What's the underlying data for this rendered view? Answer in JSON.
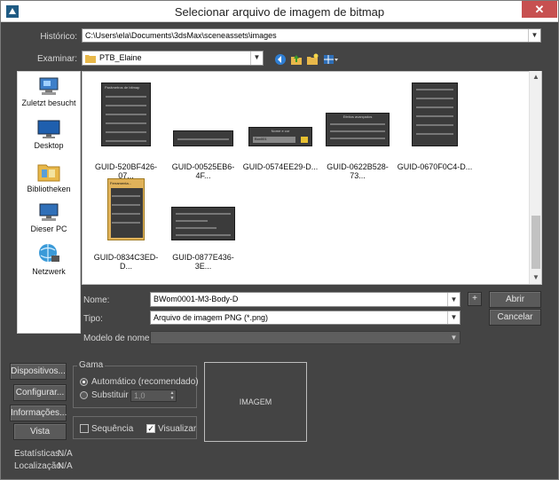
{
  "window": {
    "title": "Selecionar arquivo de imagem de bitmap",
    "close_glyph": "✕"
  },
  "history": {
    "label": "Histórico:",
    "value": "C:\\Users\\ela\\Documents\\3dsMax\\sceneassets\\images"
  },
  "look_in": {
    "label": "Examinar:",
    "value": "PTB_Elaine"
  },
  "toolbar": {
    "icons": [
      "back-icon",
      "up-folder-icon",
      "new-folder-icon",
      "view-menu-icon"
    ]
  },
  "places": [
    {
      "label": "Zuletzt besucht",
      "icon": "recent-places-icon"
    },
    {
      "label": "Desktop",
      "icon": "desktop-icon"
    },
    {
      "label": "Bibliotheken",
      "icon": "libraries-icon"
    },
    {
      "label": "Dieser PC",
      "icon": "computer-icon"
    },
    {
      "label": "Netzwerk",
      "icon": "network-icon"
    }
  ],
  "files": [
    {
      "name": "GUID-520BF426-07..."
    },
    {
      "name": "GUID-00525EB6-4F..."
    },
    {
      "name": "GUID-0574EE29-D..."
    },
    {
      "name": "GUID-0622B528-73..."
    },
    {
      "name": "GUID-0670F0C4-D..."
    },
    {
      "name": "GUID-0834C3ED-D..."
    },
    {
      "name": "GUID-0877E436-3E..."
    }
  ],
  "thumb_text": {
    "t1": "Parâmetros de bitmap",
    "t3": "Nome e cor",
    "t3_field": "Box001",
    "t4": "Efeitos avançados",
    "t6": "Ferramenta..."
  },
  "filename": {
    "label": "Nome:",
    "value": "BWom0001-M3-Body-D"
  },
  "filetype": {
    "label": "Tipo:",
    "value": "Arquivo de imagem PNG (*.png)"
  },
  "name_template": {
    "label": "Modelo de nome:",
    "value": ""
  },
  "buttons": {
    "plus": "+",
    "open": "Abrir",
    "cancel": "Cancelar",
    "devices": "Dispositivos...",
    "setup": "Configurar...",
    "info": "Informações...",
    "view": "Vista"
  },
  "gamma": {
    "title": "Gama",
    "auto_label": "Automático (recomendado)",
    "override_label": "Substituir",
    "override_value": "1,0"
  },
  "sequence_label": "Sequência",
  "preview_label": "Visualizar",
  "preview_text": "IMAGEM",
  "stats": {
    "label": "Estatísticas:",
    "value": "N/A"
  },
  "location": {
    "label": "Localização:",
    "value": "N/A"
  },
  "colors": {
    "window_bg": "#444444",
    "close_red": "#c75050",
    "thumb_gold": "#e0b25a"
  }
}
